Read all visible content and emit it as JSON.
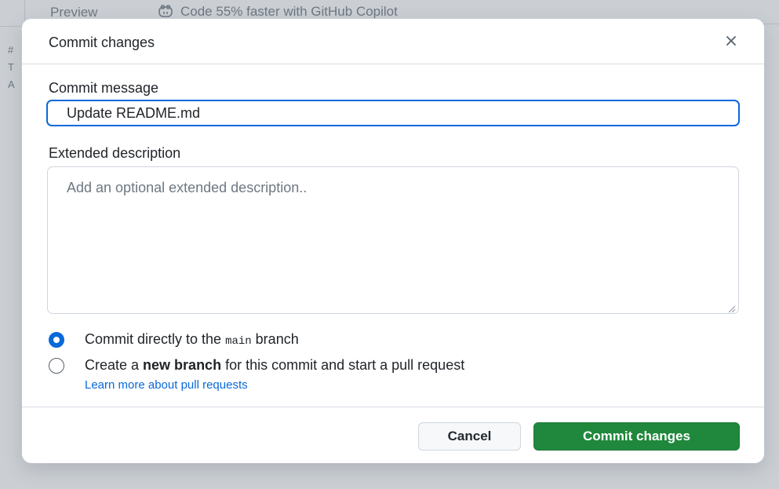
{
  "background": {
    "tab_preview": "Preview",
    "copilot_promo": "Code 55% faster with GitHub Copilot",
    "side_chars": [
      "#",
      "T",
      "A"
    ]
  },
  "modal": {
    "title": "Commit changes",
    "close_icon": "close-icon",
    "commit_message_label": "Commit message",
    "commit_message_value": "Update README.md",
    "extended_description_label": "Extended description",
    "extended_description_placeholder": "Add an optional extended description..",
    "options": {
      "direct": {
        "prefix": "Commit directly to the ",
        "branch": "main",
        "suffix": " branch",
        "selected": true
      },
      "new_branch": {
        "prefix": "Create a ",
        "bold": "new branch",
        "suffix": " for this commit and start a pull request",
        "selected": false
      }
    },
    "learn_more_link": "Learn more about pull requests",
    "cancel_label": "Cancel",
    "commit_label": "Commit changes"
  },
  "colors": {
    "accent": "#0969da",
    "commit_button": "#1f883d"
  }
}
